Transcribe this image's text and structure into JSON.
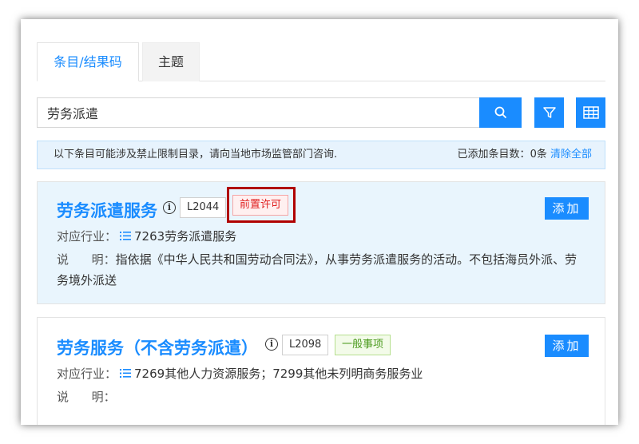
{
  "tabs": [
    {
      "label": "条目/结果码"
    },
    {
      "label": "主题"
    }
  ],
  "search": {
    "value": "劳务派遣",
    "placeholder": ""
  },
  "notice": {
    "text": "以下条目可能涉及禁止限制目录，请向当地市场监管部门咨询.",
    "added_label": "已添加条目数：",
    "added_count": "0条",
    "clear_all": "清除全部"
  },
  "items": [
    {
      "title": "劳务派遣服务",
      "code": "L2044",
      "tag": "前置许可",
      "add_label": "添加",
      "industry_label": "对应行业：",
      "industry_value": "7263劳务派遣服务",
      "desc_label": "说      明：",
      "desc_value": "指依据《中华人民共和国劳动合同法》，从事劳务派遣服务的活动。不包括海员外派、劳务境外派送"
    },
    {
      "title": "劳务服务（不含劳务派遣）",
      "code": "L2098",
      "tag": "一般事项",
      "add_label": "添加",
      "industry_label": "对应行业：",
      "industry_value": "7269其他人力资源服务；7299其他未列明商务服务业",
      "desc_label": "说      明：",
      "desc_value": ""
    }
  ],
  "colors": {
    "accent": "#1a8cff",
    "tag_red": "#e02020",
    "tag_green": "#4a9a1c",
    "highlight": "#b00000"
  },
  "icons": [
    "search-icon",
    "filter-icon",
    "grid-icon",
    "info-icon",
    "list-icon"
  ]
}
